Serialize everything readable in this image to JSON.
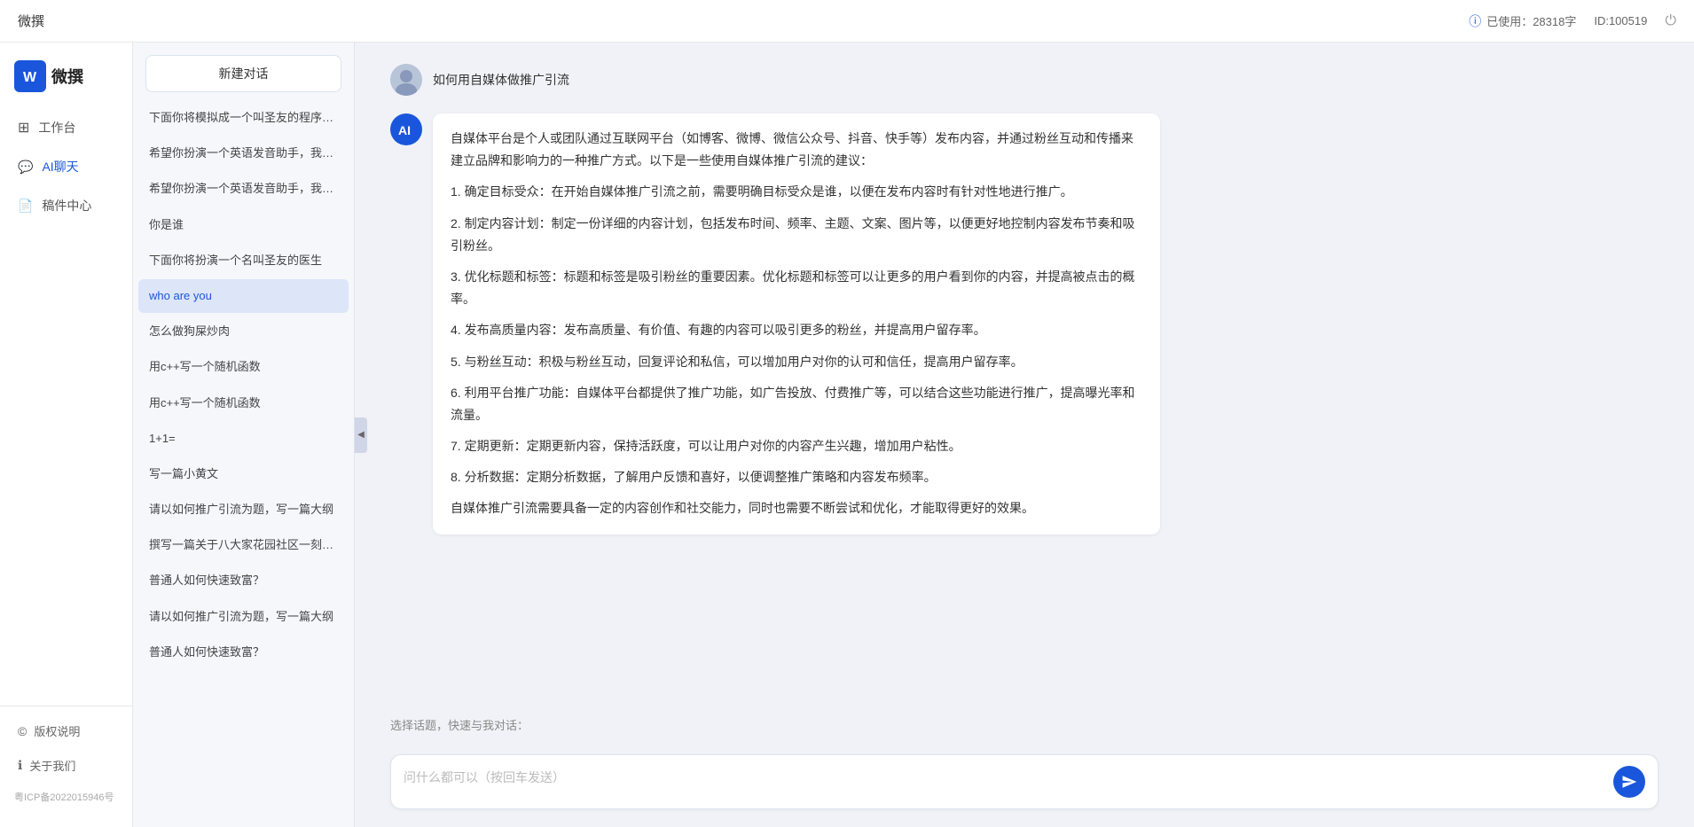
{
  "header": {
    "title": "微撰",
    "usage_label": "已使用：28318字",
    "id_label": "ID:100519",
    "usage_icon": "ⓘ"
  },
  "sidebar": {
    "logo_text": "微撰",
    "nav_items": [
      {
        "id": "workbench",
        "label": "工作台",
        "icon": "⊞"
      },
      {
        "id": "ai-chat",
        "label": "AI聊天",
        "icon": "💬"
      },
      {
        "id": "drafts",
        "label": "稿件中心",
        "icon": "📄"
      }
    ],
    "bottom_items": [
      {
        "id": "copyright",
        "label": "版权说明",
        "icon": "©"
      },
      {
        "id": "about",
        "label": "关于我们",
        "icon": "ℹ"
      }
    ],
    "icp": "粤ICP备2022015946号"
  },
  "history": {
    "new_btn_label": "新建对话",
    "items": [
      {
        "id": "h1",
        "text": "下面你将模拟成一个叫圣友的程序员，我说...",
        "active": false
      },
      {
        "id": "h2",
        "text": "希望你扮演一个英语发音助手，我提供给你...",
        "active": false
      },
      {
        "id": "h3",
        "text": "希望你扮演一个英语发音助手，我提供给你...",
        "active": false
      },
      {
        "id": "h4",
        "text": "你是谁",
        "active": false
      },
      {
        "id": "h5",
        "text": "下面你将扮演一个名叫圣友的医生",
        "active": false
      },
      {
        "id": "h6",
        "text": "who are you",
        "active": true
      },
      {
        "id": "h7",
        "text": "怎么做狗屎炒肉",
        "active": false
      },
      {
        "id": "h8",
        "text": "用c++写一个随机函数",
        "active": false
      },
      {
        "id": "h9",
        "text": "用c++写一个随机函数",
        "active": false
      },
      {
        "id": "h10",
        "text": "1+1=",
        "active": false
      },
      {
        "id": "h11",
        "text": "写一篇小黄文",
        "active": false
      },
      {
        "id": "h12",
        "text": "请以如何推广引流为题，写一篇大纲",
        "active": false
      },
      {
        "id": "h13",
        "text": "撰写一篇关于八大家花园社区一刻钟便民生...",
        "active": false
      },
      {
        "id": "h14",
        "text": "普通人如何快速致富？",
        "active": false
      },
      {
        "id": "h15",
        "text": "请以如何推广引流为题，写一篇大纲",
        "active": false
      },
      {
        "id": "h16",
        "text": "普通人如何快速致富？",
        "active": false
      }
    ]
  },
  "chat": {
    "user_question": "如何用自媒体做推广引流",
    "ai_response_paragraphs": [
      "自媒体平台是个人或团队通过互联网平台（如博客、微博、微信公众号、抖音、快手等）发布内容，并通过粉丝互动和传播来建立品牌和影响力的一种推广方式。以下是一些使用自媒体推广引流的建议：",
      "1. 确定目标受众：在开始自媒体推广引流之前，需要明确目标受众是谁，以便在发布内容时有针对性地进行推广。",
      "2. 制定内容计划：制定一份详细的内容计划，包括发布时间、频率、主题、文案、图片等，以便更好地控制内容发布节奏和吸引粉丝。",
      "3. 优化标题和标签：标题和标签是吸引粉丝的重要因素。优化标题和标签可以让更多的用户看到你的内容，并提高被点击的概率。",
      "4. 发布高质量内容：发布高质量、有价值、有趣的内容可以吸引更多的粉丝，并提高用户留存率。",
      "5. 与粉丝互动：积极与粉丝互动，回复评论和私信，可以增加用户对你的认可和信任，提高用户留存率。",
      "6. 利用平台推广功能：自媒体平台都提供了推广功能，如广告投放、付费推广等，可以结合这些功能进行推广，提高曝光率和流量。",
      "7. 定期更新：定期更新内容，保持活跃度，可以让用户对你的内容产生兴趣，增加用户粘性。",
      "8. 分析数据：定期分析数据，了解用户反馈和喜好，以便调整推广策略和内容发布频率。",
      "自媒体推广引流需要具备一定的内容创作和社交能力，同时也需要不断尝试和优化，才能取得更好的效果。"
    ]
  },
  "input": {
    "placeholder": "问什么都可以（按回车发送）",
    "quick_topics_label": "选择话题，快速与我对话："
  }
}
